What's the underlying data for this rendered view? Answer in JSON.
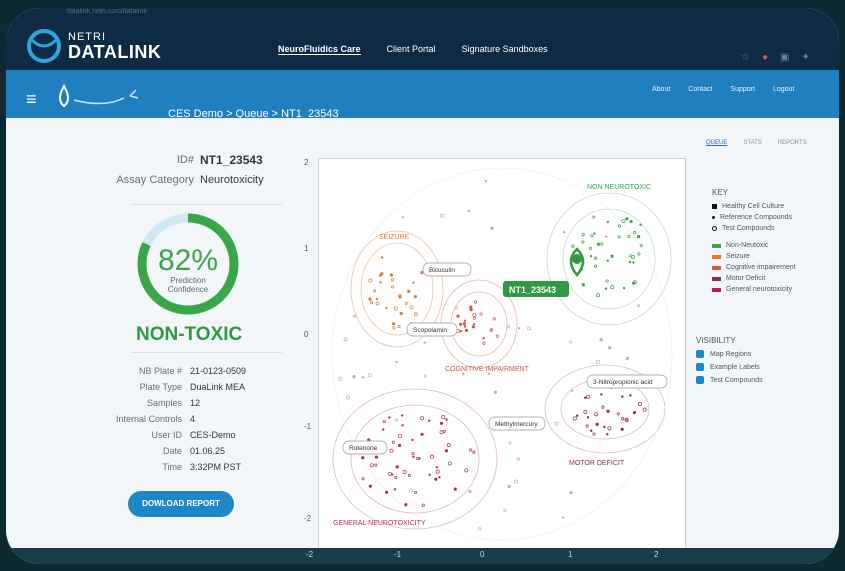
{
  "browser": {
    "url": "datalink.netri.com/datalink"
  },
  "app": {
    "logo_line1": "NETRI",
    "logo_line2": "DATALINK"
  },
  "nav": {
    "main": [
      "NeuroFluidics Care",
      "Client Portal",
      "Signature Sandboxes"
    ],
    "right": [
      "About",
      "Contact",
      "Support",
      "Logout"
    ]
  },
  "breadcrumb": "CES Demo > Queue > NT1_23543",
  "tabs": [
    "QUEUE",
    "STATS",
    "REPORTS"
  ],
  "summary": {
    "id_label": "ID#",
    "id_value": "NT1_23543",
    "assay_label": "Assay Category",
    "assay_value": "Neurotoxicity",
    "confidence_value": "82%",
    "confidence_label_1": "Prediction",
    "confidence_label_2": "Confidence",
    "confidence_fraction": 0.82,
    "result": "NON-TOXIC"
  },
  "details": [
    {
      "label": "NB Plate #",
      "value": "21-0123-0509"
    },
    {
      "label": "Plate Type",
      "value": "DuaLink MEA"
    },
    {
      "label": "Samples",
      "value": "12"
    },
    {
      "label": "Internal Controls",
      "value": "4"
    },
    {
      "label": "User ID",
      "value": "CES-Demo"
    },
    {
      "label": "Date",
      "value": "01.06.25"
    },
    {
      "label": "Time",
      "value": "3:32PM PST"
    }
  ],
  "download_button": "DOWLOAD REPORT",
  "chart_data": {
    "type": "scatter",
    "xticks": [
      "-2",
      "-1",
      "0",
      "1",
      "2"
    ],
    "yticks": [
      "2",
      "1",
      "0",
      "-1",
      "-2"
    ],
    "xlim": [
      -2,
      2
    ],
    "ylim": [
      -2,
      2
    ],
    "regions": [
      {
        "label": "SEIZURE",
        "color": "#e07a2e"
      },
      {
        "label": "NON NEUROTOXIC",
        "color": "#3aa64a"
      },
      {
        "label": "COGNITIVE IMPAIRMENT",
        "color": "#d9534f"
      },
      {
        "label": "MOTOR DEFICIT",
        "color": "#8a2c5a"
      },
      {
        "label": "GENERAL NEUROTOXICITY",
        "color": "#b0335f"
      }
    ],
    "example_labels": [
      "Bicuculin",
      "Scopolamin",
      "3-Nitropropionic acid",
      "Methylmercury",
      "Rotenone"
    ],
    "test_compound": {
      "label": "NT1_23543",
      "x": 0.85,
      "y": 0.85
    }
  },
  "key": {
    "title": "KEY",
    "markers": [
      "Healthy Cell Culture",
      "Reference Compounds",
      "Test Compounds"
    ],
    "categories": [
      {
        "label": "Non-Neutoxic",
        "color": "#3aa64a"
      },
      {
        "label": "Seizure",
        "color": "#e07a2e"
      },
      {
        "label": "Cognitive impairement",
        "color": "#d9534f"
      },
      {
        "label": "Motor Deficit",
        "color": "#8a2c5a"
      },
      {
        "label": "General neurotoxicity",
        "color": "#c2185b"
      }
    ]
  },
  "visibility": {
    "title": "VISIBILITY",
    "toggles": [
      "Map Regions",
      "Example Labels",
      "Test Compounds"
    ]
  }
}
